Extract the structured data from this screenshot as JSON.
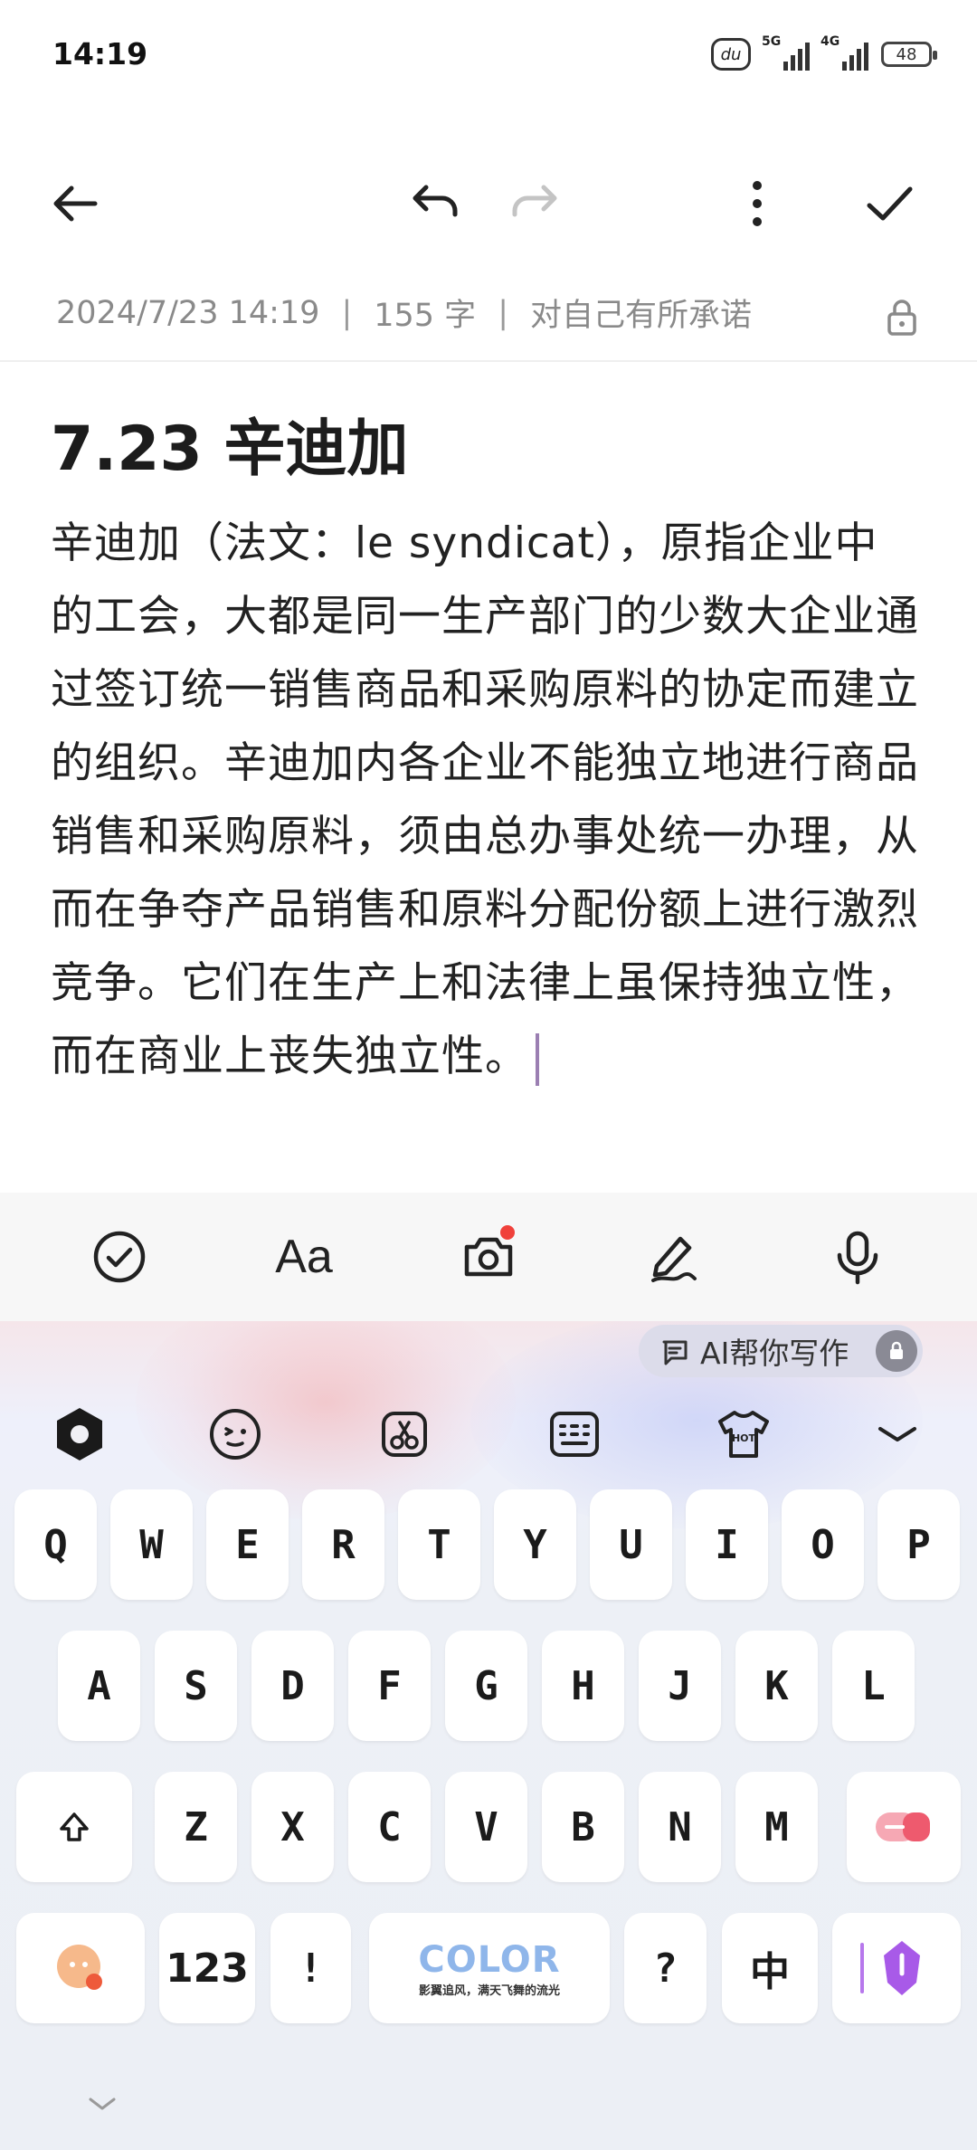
{
  "status_bar": {
    "time": "14:19",
    "network_1": "5G",
    "network_2": "4G",
    "battery": "48",
    "badge_text": "du"
  },
  "toolbar": {
    "back_icon": "arrow-left-icon",
    "undo_icon": "undo-icon",
    "redo_icon": "redo-icon",
    "more_icon": "more-vertical-icon",
    "done_icon": "check-icon"
  },
  "meta": {
    "datetime": "2024/7/23 14:19",
    "separator": "|",
    "word_count": "155 字",
    "folder": "对自己有所承诺"
  },
  "note": {
    "title": "7.23 辛迪加",
    "body": "辛迪加（法文：le syndicat），原指企业中的工会，大都是同一生产部门的少数大企业通过签订统一销售商品和采购原料的协定而建立的组织。辛迪加内各企业不能独立地进行商品销售和采购原料，须由总办事处统一办理，从而在争夺产品销售和原料分配份额上进行激烈竞争。它们在生产上和法律上虽保持独立性，而在商业上丧失独立性。"
  },
  "edit_tools": [
    "checklist-icon",
    "text-format-icon",
    "camera-icon",
    "handwriting-icon",
    "microphone-icon"
  ],
  "edit_tools_label": "Aa",
  "keyboard": {
    "ai_pill": "AI帮你写作",
    "toolbar_icons": [
      "hexagon-logo-icon",
      "emoji-icon",
      "clipboard-scissors-icon",
      "keyboard-layout-icon",
      "hot-shirt-icon",
      "collapse-icon"
    ],
    "hot_label": "HOT",
    "row1": [
      "Q",
      "W",
      "E",
      "R",
      "T",
      "Y",
      "U",
      "I",
      "O",
      "P"
    ],
    "row2": [
      "A",
      "S",
      "D",
      "F",
      "G",
      "H",
      "J",
      "K",
      "L"
    ],
    "row3": [
      "Z",
      "X",
      "C",
      "V",
      "B",
      "N",
      "M"
    ],
    "num_key": "123",
    "punct_key": "!",
    "space_label": "COLOR",
    "space_sub": "影翼追风，满天飞舞的流光",
    "question_key": "?",
    "lang_key": "中",
    "accent_blue": "#8fb6ea",
    "accent_purple": "#a85ae8"
  }
}
